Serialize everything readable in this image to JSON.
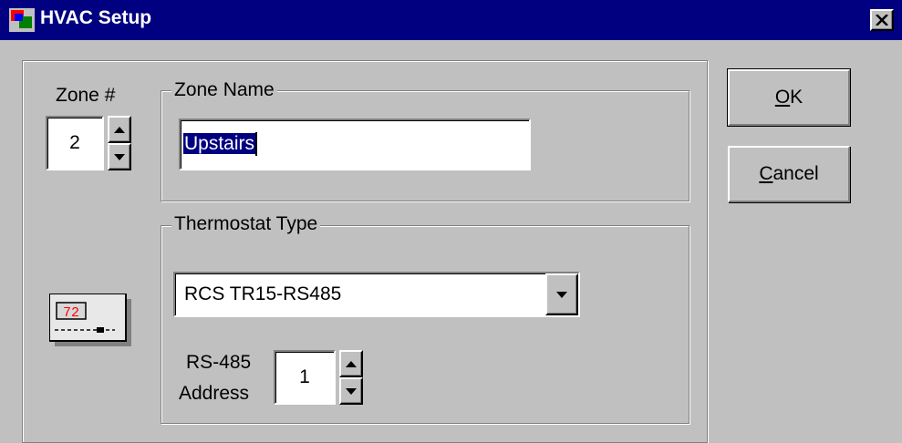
{
  "window": {
    "title": "HVAC Setup",
    "icons": {
      "app": "hvac-app-icon",
      "close": "close-icon"
    }
  },
  "zone": {
    "number_label": "Zone #",
    "number_value": "2",
    "name_group_label": "Zone Name",
    "name_value": "Upstairs"
  },
  "thermostat": {
    "group_label": "Thermostat Type",
    "type_value": "RCS TR15-RS485",
    "address_label_line1": "RS-485",
    "address_label_line2": "Address",
    "address_value": "1",
    "display_text": "72",
    "icon": "thermostat-icon"
  },
  "buttons": {
    "ok_label": "K",
    "ok_mnemonic": "O",
    "cancel_label": "ancel",
    "cancel_mnemonic": "C"
  },
  "colors": {
    "titlebar": "#000080",
    "face": "#c0c0c0",
    "selection": "#000080",
    "thermo_display": "#ff0000"
  }
}
